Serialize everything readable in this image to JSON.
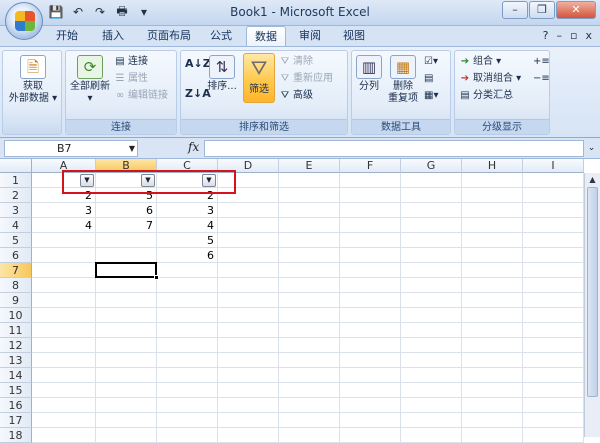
{
  "window": {
    "title": "Book1 - Microsoft Excel"
  },
  "tabs": [
    "开始",
    "插入",
    "页面布局",
    "公式",
    "数据",
    "审阅",
    "视图"
  ],
  "active_tab": "数据",
  "ribbon": {
    "get_external": {
      "line1": "获取",
      "line2": "外部数据"
    },
    "refresh_all": "全部刷新",
    "connections": "连接",
    "properties": "属性",
    "edit_links": "编辑链接",
    "group_connections": "连接",
    "sort": "排序...",
    "filter": "筛选",
    "clear": "清除",
    "reapply": "重新应用",
    "advanced": "高级",
    "group_sortfilter": "排序和筛选",
    "text_to_columns": "分列",
    "remove_dup": {
      "line1": "删除",
      "line2": "重复项"
    },
    "group_datatools": "数据工具",
    "group": "组合",
    "ungroup": "取消组合",
    "subtotal": "分类汇总",
    "group_outline": "分级显示"
  },
  "formula_bar": {
    "name_box": "B7",
    "fx_label": "fx",
    "value": ""
  },
  "columns": [
    "A",
    "B",
    "C",
    "D",
    "E",
    "F",
    "G",
    "H",
    "I"
  ],
  "rows": [
    "1",
    "2",
    "3",
    "4",
    "5",
    "6",
    "7",
    "8",
    "9",
    "10",
    "11",
    "12",
    "13",
    "14",
    "15",
    "16",
    "17",
    "18"
  ],
  "selected_cell": "B7",
  "cells": {
    "A2": "2",
    "B2": "5",
    "C2": "2",
    "A3": "3",
    "B3": "6",
    "C3": "3",
    "A4": "4",
    "B4": "7",
    "C4": "4",
    "C5": "5",
    "C6": "6"
  },
  "filter_columns": [
    "A",
    "B",
    "C"
  ],
  "icons": {
    "dropdown": "▾",
    "filter_arrow": "▼"
  }
}
